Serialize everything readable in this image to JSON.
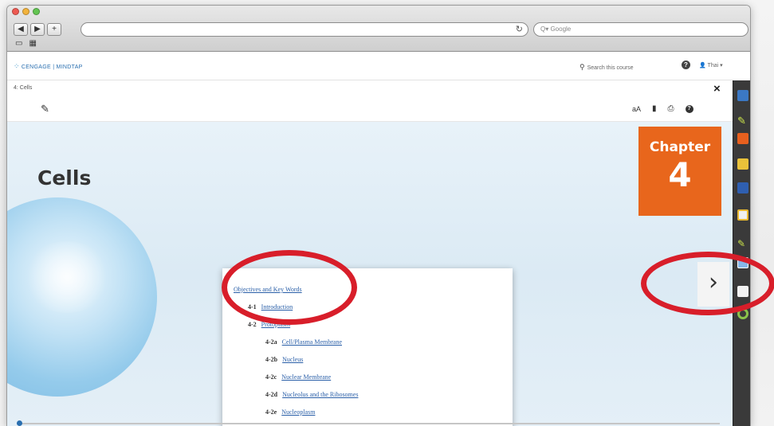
{
  "browser": {
    "nav_back": "◀",
    "nav_forward": "▶",
    "nav_add": "+",
    "reload_icon": "reload-icon",
    "search_placeholder": "Q▾ Google",
    "bookmarks": [
      "▭",
      "▦"
    ]
  },
  "header": {
    "logo_text": "CENGAGE | MINDTAP",
    "search_placeholder": "Search this course",
    "help": "?",
    "user": "Thai ▾"
  },
  "breadcrumb": {
    "text": "4: Cells",
    "close": "×"
  },
  "toolbar": {
    "font_size": "aA"
  },
  "content": {
    "title": "Cells",
    "chapter_label": "Chapter",
    "chapter_number": "4",
    "next": "›"
  },
  "toc": [
    {
      "num": "",
      "label": "Objectives and Key Words",
      "level": 0
    },
    {
      "num": "4-1",
      "label": "Introduction",
      "level": 0
    },
    {
      "num": "4-2",
      "label": "Protoplasm",
      "level": 0
    },
    {
      "num": "4-2a",
      "label": "Cell/Plasma Membrane",
      "level": 1
    },
    {
      "num": "4-2b",
      "label": "Nucleus",
      "level": 1
    },
    {
      "num": "4-2c",
      "label": "Nuclear Membrane",
      "level": 1
    },
    {
      "num": "4-2d",
      "label": "Nucleolus and the Ribosomes",
      "level": 1
    },
    {
      "num": "4-2e",
      "label": "Nucleoplasm",
      "level": 1
    }
  ],
  "colors": {
    "chapter_accent": "#e8661c",
    "annotation_red": "#d81e2a",
    "link_blue": "#2a5fa8"
  }
}
